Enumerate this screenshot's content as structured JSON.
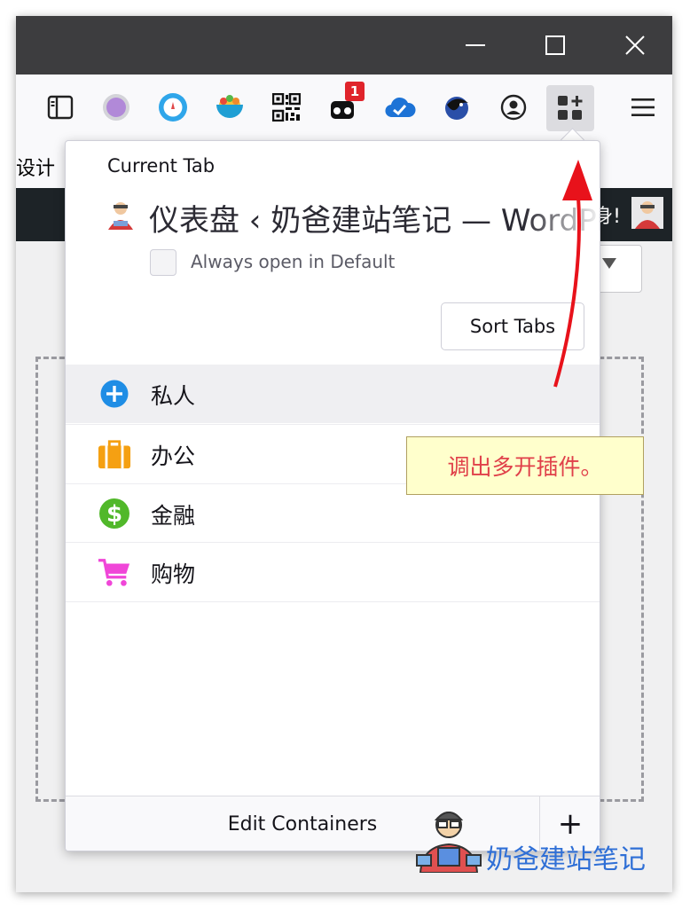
{
  "window": {
    "minimize_glyph": "—",
    "maximize_glyph": "☐",
    "close_glyph": "✕"
  },
  "toolbar": {
    "icons": [
      "sidebar-icon",
      "purple-circle-extension-icon",
      "speed-dial-extension-icon",
      "rainbow-bowl-extension-icon",
      "qr-code-extension-icon",
      "mask-extension-icon",
      "cloud-check-extension-icon",
      "dragon-extension-icon",
      "account-icon",
      "multi-account-containers-icon",
      "menu-icon"
    ],
    "badge_count": "1"
  },
  "page": {
    "left_text": "设计",
    "adminbar_right_text": "身!"
  },
  "popup": {
    "current_tab_label": "Current Tab",
    "tab_title": "仪表盘 ‹ 奶爸建站笔记 — WordPress",
    "always_open_label": "Always open in Default",
    "sort_tabs_label": "Sort Tabs",
    "containers": [
      {
        "name": "私人",
        "icon": "plus-circle-icon",
        "color": "#1f8de5"
      },
      {
        "name": "办公",
        "icon": "briefcase-icon",
        "color": "#f5a012"
      },
      {
        "name": "金融",
        "icon": "dollar-icon",
        "color": "#51b82a"
      },
      {
        "name": "购物",
        "icon": "cart-icon",
        "color": "#f046d8"
      }
    ],
    "edit_containers_label": "Edit Containers",
    "add_label": "+"
  },
  "annotation": {
    "callout_text": "调出多开插件。",
    "arrow_color": "#e8121b"
  },
  "watermark": {
    "text": "奶爸建站笔记"
  }
}
